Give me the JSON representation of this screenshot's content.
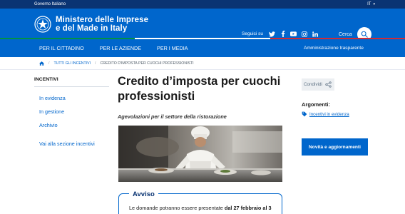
{
  "slim_header": {
    "gov_label": "Governo Italiano",
    "lang": "IT"
  },
  "header": {
    "brand_line1": "Ministero delle Imprese",
    "brand_line2": "e del Made in Italy",
    "social_label": "Seguici su",
    "social_icons": [
      "twitter-icon",
      "facebook-icon",
      "youtube-icon",
      "instagram-icon",
      "linkedin-icon"
    ],
    "search_label": "Cerca"
  },
  "nav": {
    "items": [
      "PER IL CITTADINO",
      "PER LE AZIENDE",
      "PER I MEDIA"
    ],
    "right": "Amministrazione trasparente"
  },
  "breadcrumb": {
    "items": [
      "TUTTI GLI INCENTIVI",
      "CREDITO D'IMPOSTA PER CUOCHI PROFESSIONISTI"
    ]
  },
  "sidebar": {
    "title": "INCENTIVI",
    "links": [
      "In evidenza",
      "In gestione",
      "Archivio"
    ],
    "section_link": "Vai alla sezione incentivi"
  },
  "main": {
    "title_line1": "Credito d’imposta per cuochi",
    "title_line2": "professionisti",
    "subtitle": "Agevolazioni per il settore della ristorazione"
  },
  "avviso": {
    "title": "Avviso",
    "text_prefix": "Le domande potranno essere presentate",
    "text_bold": "dal 27 febbraio al 3"
  },
  "aside": {
    "share_label": "Condividi",
    "argomenti_label": "Argomenti:",
    "tag_label": "Incentivi in evidenza",
    "news_button": "Novità e aggiornamenti"
  },
  "colors": {
    "primary": "#0066cc",
    "dark_blue": "#0a3473",
    "italy_green": "#009246",
    "italy_red": "#ce2b37"
  }
}
